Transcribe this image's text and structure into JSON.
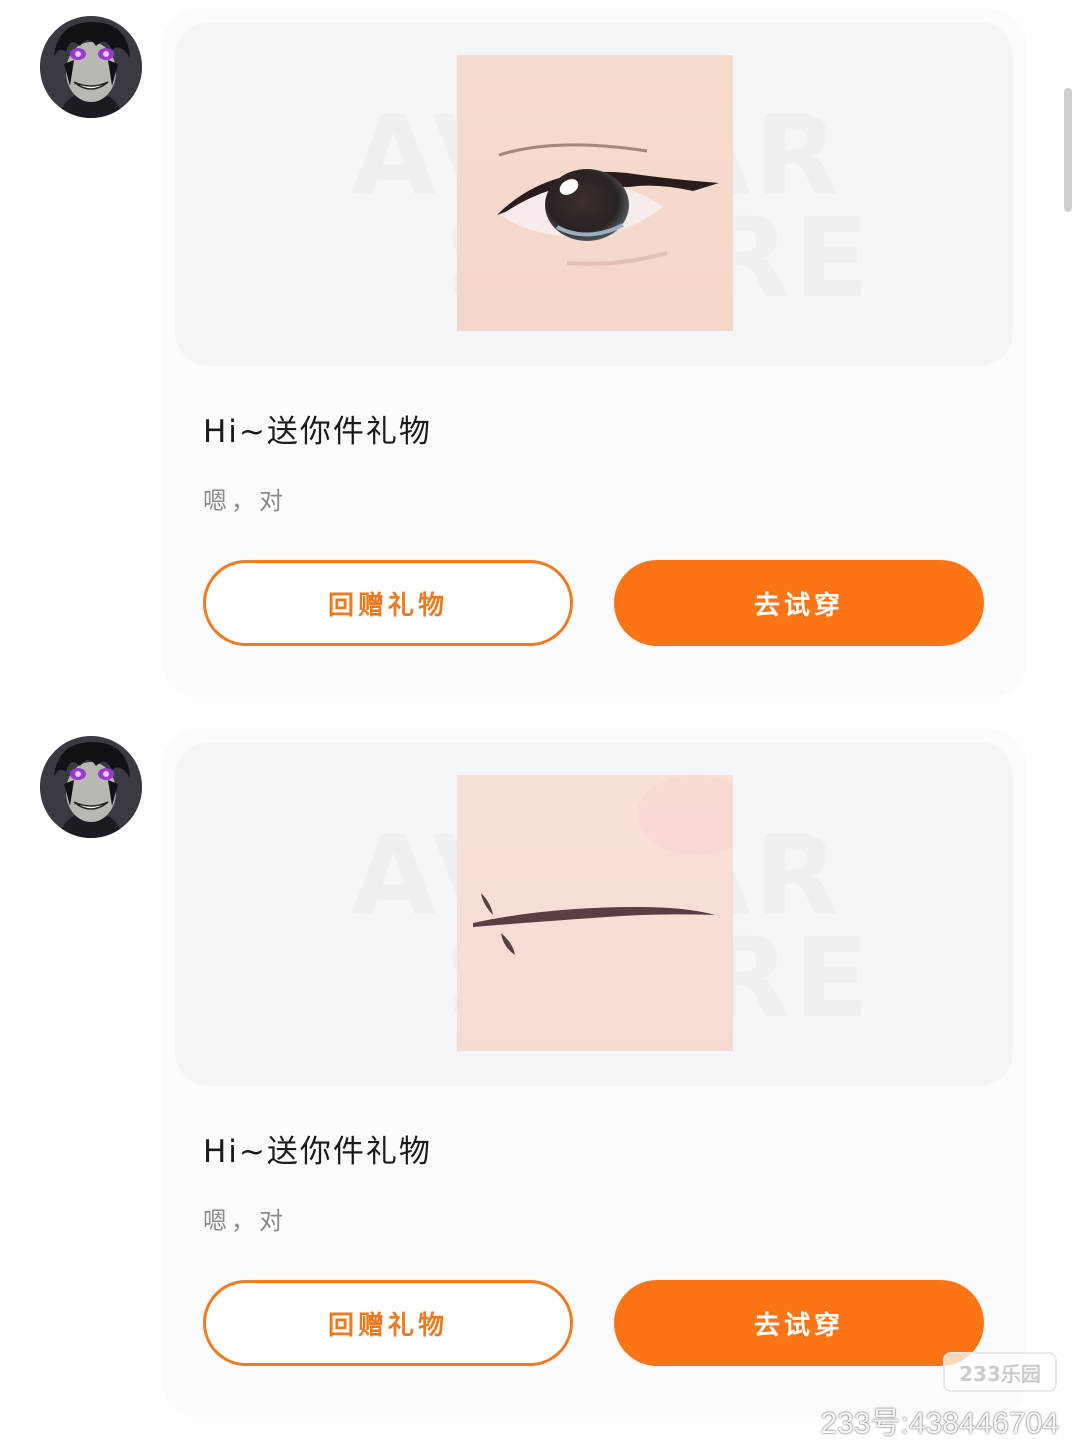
{
  "messages": [
    {
      "avatar_icon": "anime-character-avatar",
      "item_icon": "eye-makeup-icon",
      "title": "Hi~送你件礼物",
      "subtitle": "嗯，对",
      "return_gift_label": "回赠礼物",
      "try_on_label": "去试穿"
    },
    {
      "avatar_icon": "anime-character-avatar",
      "item_icon": "mouth-makeup-icon",
      "title": "Hi~送你件礼物",
      "subtitle": "嗯，对",
      "return_gift_label": "回赠礼物",
      "try_on_label": "去试穿"
    }
  ],
  "watermark": {
    "stamp_text": "233乐园",
    "id_text": "233号:438446704"
  },
  "colors": {
    "accent": "#fb7516",
    "card_background": "#fbfbfd",
    "preview_background": "#f4f5f8"
  }
}
